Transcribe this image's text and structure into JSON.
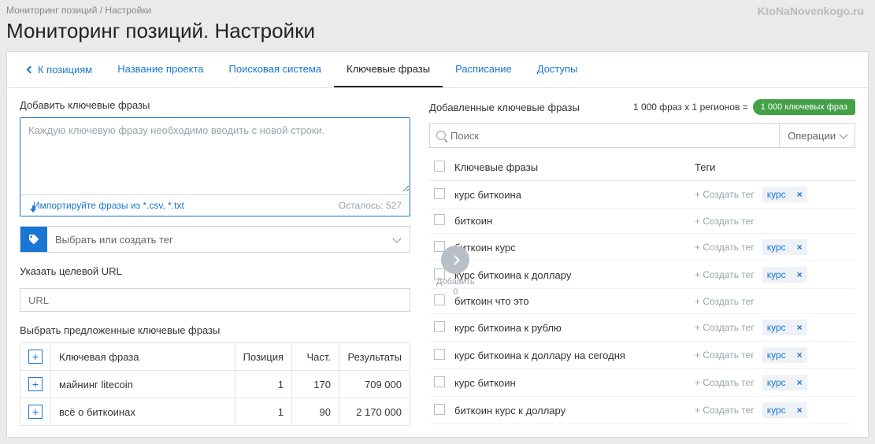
{
  "breadcrumb": "Мониторинг позиций / Настройки",
  "watermark": "KtoNaNovenkogo.ru",
  "page_title": "Мониторинг позиций. Настройки",
  "tabs": {
    "back": "К позициям",
    "items": [
      "Название проекта",
      "Поисковая система",
      "Ключевые фразы",
      "Расписание",
      "Доступы"
    ],
    "active_index": 2
  },
  "left": {
    "add_label": "Добавить ключевые фразы",
    "textarea_placeholder": "Каждую ключевую фразу необходимо вводить с новой строки.",
    "import_link": "Импортируйте фразы из *.csv, *.txt",
    "remaining": "Осталось: 527",
    "tag_select_placeholder": "Выбрать или создать тег",
    "url_label": "Указать целевой URL",
    "url_placeholder": "URL",
    "suggest_label": "Выбрать предложенные ключевые фразы",
    "suggest_headers": [
      "Ключевая фраза",
      "Позиция",
      "Част.",
      "Результаты"
    ],
    "suggest_rows": [
      {
        "phrase": "майнинг litecoin",
        "position": "1",
        "freq": "170",
        "results": "709 000"
      },
      {
        "phrase": "всё о биткоинах",
        "position": "1",
        "freq": "90",
        "results": "2 170 000"
      }
    ]
  },
  "add_button": {
    "label": "Добавить",
    "count": "0"
  },
  "right": {
    "title": "Добавленные ключевые фразы",
    "summary_text": "1 000 фраз x 1 регионов =",
    "summary_badge": "1 000 ключевых фраз",
    "search_placeholder": "Поиск",
    "operations": "Операции",
    "headers": {
      "phrase": "Ключевые фразы",
      "tags": "Теги"
    },
    "create_tag": "Создать тег",
    "tag_name": "курс",
    "rows": [
      {
        "phrase": "курс биткоина",
        "has_tag": true
      },
      {
        "phrase": "биткоин",
        "has_tag": false
      },
      {
        "phrase": "биткоин курс",
        "has_tag": true
      },
      {
        "phrase": "курс биткоина к доллару",
        "has_tag": true
      },
      {
        "phrase": "биткоин что это",
        "has_tag": false
      },
      {
        "phrase": "курс биткоина к рублю",
        "has_tag": true
      },
      {
        "phrase": "курс биткоина к доллару на сегодня",
        "has_tag": true
      },
      {
        "phrase": "курс биткоин",
        "has_tag": true
      },
      {
        "phrase": "биткоин курс к доллару",
        "has_tag": true
      }
    ]
  }
}
